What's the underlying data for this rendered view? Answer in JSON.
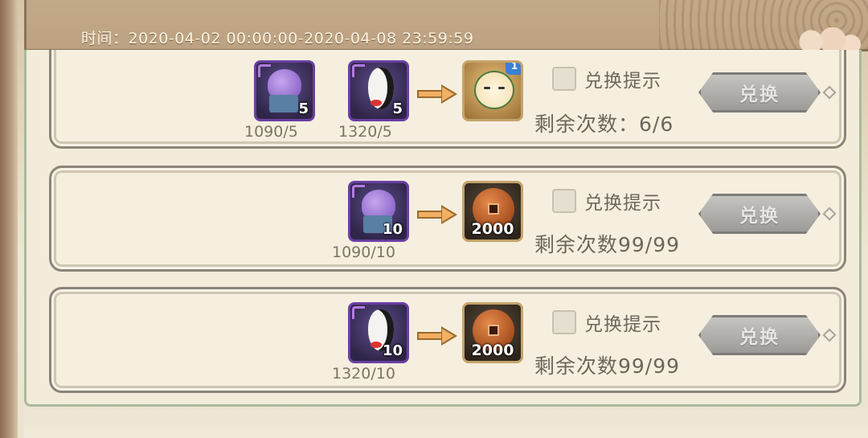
{
  "header": {
    "time_range": "时间：2020-04-02  00:00:00-2020-04-08  23:59:59"
  },
  "rows": [
    {
      "costs": [
        {
          "icon": "purple-octopus-box-icon",
          "qty": "5",
          "label": "1090/5"
        },
        {
          "icon": "black-white-mask-icon",
          "qty": "5",
          "label": "1320/5"
        }
      ],
      "reward": {
        "icon": "chibi-character-icon",
        "qty": "",
        "badge": "1"
      },
      "hint_label": "兑换提示",
      "remaining": "剩余次数：6/6",
      "button_label": "兑换"
    },
    {
      "costs": [
        {
          "icon": "purple-octopus-box-icon",
          "qty": "10",
          "label": "1090/10"
        }
      ],
      "reward": {
        "icon": "copper-coin-icon",
        "qty": "2000"
      },
      "hint_label": "兑换提示",
      "remaining": "剩余次数99/99",
      "button_label": "兑换"
    },
    {
      "costs": [
        {
          "icon": "black-white-mask-icon",
          "qty": "10",
          "label": "1320/10"
        }
      ],
      "reward": {
        "icon": "copper-coin-icon",
        "qty": "2000"
      },
      "hint_label": "兑换提示",
      "remaining": "剩余次数99/99",
      "button_label": "兑换"
    }
  ],
  "colors": {
    "panel_border": "#a9ba9d",
    "button_disabled": "#9d9b97",
    "arrow": "#f1b063"
  }
}
